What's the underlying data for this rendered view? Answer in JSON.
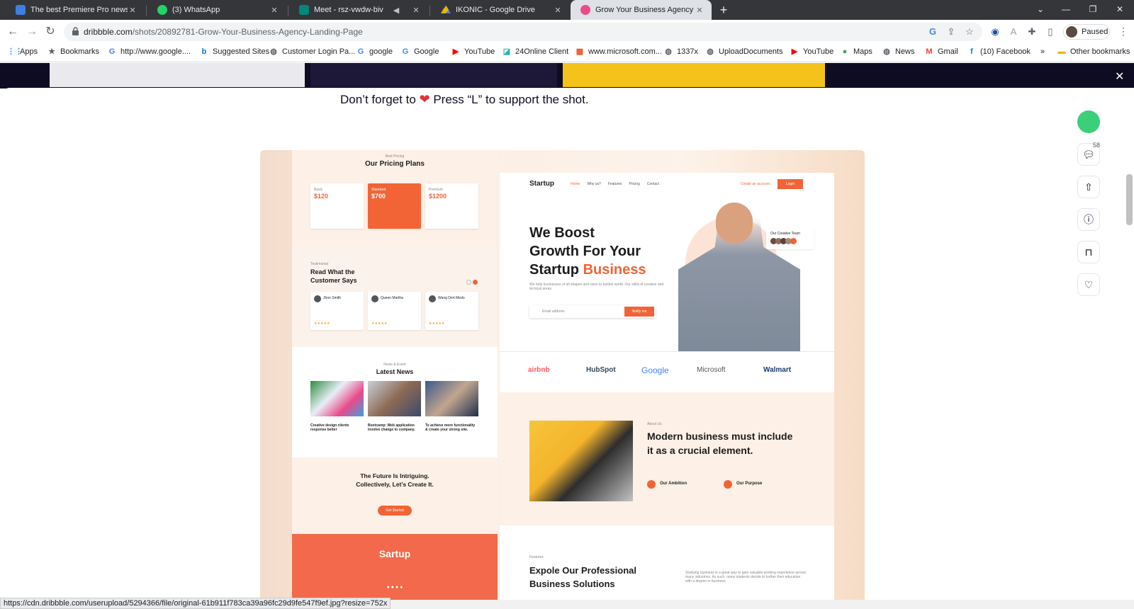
{
  "tabs": [
    {
      "title": "The best Premiere Pro news intro",
      "active": false,
      "color": "#3f7fe0"
    },
    {
      "title": "(3) WhatsApp",
      "active": false,
      "color": "#25d366"
    },
    {
      "title": "Meet - rsz-vwdw-biv",
      "active": false,
      "color": "#00897b"
    },
    {
      "title": "IKONIC - Google Drive",
      "active": false,
      "color": "#f4b400"
    },
    {
      "title": "Grow Your Business Agency Land",
      "active": true,
      "color": "#ea4c89"
    }
  ],
  "address": {
    "domain": "dribbble.com",
    "path": "/shots/20892781-Grow-Your-Business-Agency-Landing-Page"
  },
  "profile": {
    "label": "Paused"
  },
  "bookmarks": [
    {
      "label": "Apps",
      "icon": "apps-icon",
      "color": "#4285f4"
    },
    {
      "label": "Bookmarks",
      "icon": "star-icon",
      "color": "#5f6368"
    },
    {
      "label": "http://www.google....",
      "icon": "google-icon",
      "color": "#4285f4"
    },
    {
      "label": "Suggested Sites",
      "icon": "bing-icon",
      "color": "#0078d4"
    },
    {
      "label": "Customer Login Pa...",
      "icon": "globe-icon",
      "color": "#5f6368"
    },
    {
      "label": "google",
      "icon": "google-icon",
      "color": "#4285f4"
    },
    {
      "label": "Google",
      "icon": "google-icon",
      "color": "#4285f4"
    },
    {
      "label": "YouTube",
      "icon": "youtube-icon",
      "color": "#ff0000"
    },
    {
      "label": "24Online Client",
      "icon": "online-icon",
      "color": "#1fb5ad"
    },
    {
      "label": "www.microsoft.com...",
      "icon": "microsoft-icon",
      "color": "#f25022"
    },
    {
      "label": "1337x",
      "icon": "globe-icon",
      "color": "#5f6368"
    },
    {
      "label": "UploadDocuments",
      "icon": "globe-icon",
      "color": "#5f6368"
    },
    {
      "label": "YouTube",
      "icon": "youtube-icon",
      "color": "#ff0000"
    },
    {
      "label": "Maps",
      "icon": "maps-icon",
      "color": "#34a853"
    },
    {
      "label": "News",
      "icon": "globe-icon",
      "color": "#5f6368"
    },
    {
      "label": "Gmail",
      "icon": "gmail-icon",
      "color": "#ea4335"
    },
    {
      "label": "(10) Facebook",
      "icon": "facebook-icon",
      "color": "#1877f2"
    }
  ],
  "other_bookmarks": "Other bookmarks",
  "overflow": "»",
  "caption": {
    "pre": "Don’t forget to",
    "post": "Press “L” to support the shot."
  },
  "comment_count": "58",
  "status_url": "https://cdn.dribbble.com/userupload/5294366/file/original-61b911f783ca39a96fc29d9fe547f9ef.jpg?resize=752x",
  "shot": {
    "pricing": {
      "kicker": "Best Pricing",
      "title": "Our Pricing Plans",
      "plans": [
        {
          "name": "Basic",
          "price": "$120"
        },
        {
          "name": "Standard",
          "price": "$700"
        },
        {
          "name": "Premium",
          "price": "$1200"
        }
      ]
    },
    "testimonial": {
      "kicker": "Testimonial",
      "title1": "Read What the",
      "title2": "Customer Says",
      "people": [
        "Jhon Smith",
        "Queen Martha",
        "Wang Dert Medo"
      ]
    },
    "news": {
      "kicker": "News & Event",
      "title": "Latest News",
      "items": [
        "Creative design clients response better",
        "Bootcamp: Web application involve change to company.",
        "To achieve more functionality & create your strong site."
      ]
    },
    "future": {
      "title1": "The Future Is Intriguing.",
      "title2": "Collectively, Let’s Create It.",
      "button": "Get Started"
    },
    "footer_logo": "Sartup",
    "hero": {
      "logo": "Startup",
      "nav": [
        "Home",
        "Why us?",
        "Features",
        "Pricing",
        "Contact"
      ],
      "create": "Create an account",
      "login": "Login",
      "h1": "We Boost",
      "h2": "Growth For Your",
      "h3a": "Startup",
      "h3b": "Business",
      "sub": "We help businesses of all shapes and sizes to tonline world. Our skills of creative and tecnical areas.",
      "email_ph": "Email address",
      "notify": "Notify me",
      "team": "Our Creative Team"
    },
    "brands": [
      "airbnb",
      "HubSpot",
      "Google",
      "Microsoft",
      "Walmart"
    ],
    "about": {
      "kicker": "About Us",
      "t1": "Modern business must include",
      "t2": "it as a crucial element.",
      "a1": "Our Ambition",
      "a2": "Our Purpose"
    },
    "features": {
      "kicker": "Features",
      "t1": "Expole Our Professional",
      "t2": "Business Solutions",
      "desc": "Studying business is a great way to gain valuable working experience across many industries. As such, many students decide to further their education with a degree in business."
    }
  }
}
